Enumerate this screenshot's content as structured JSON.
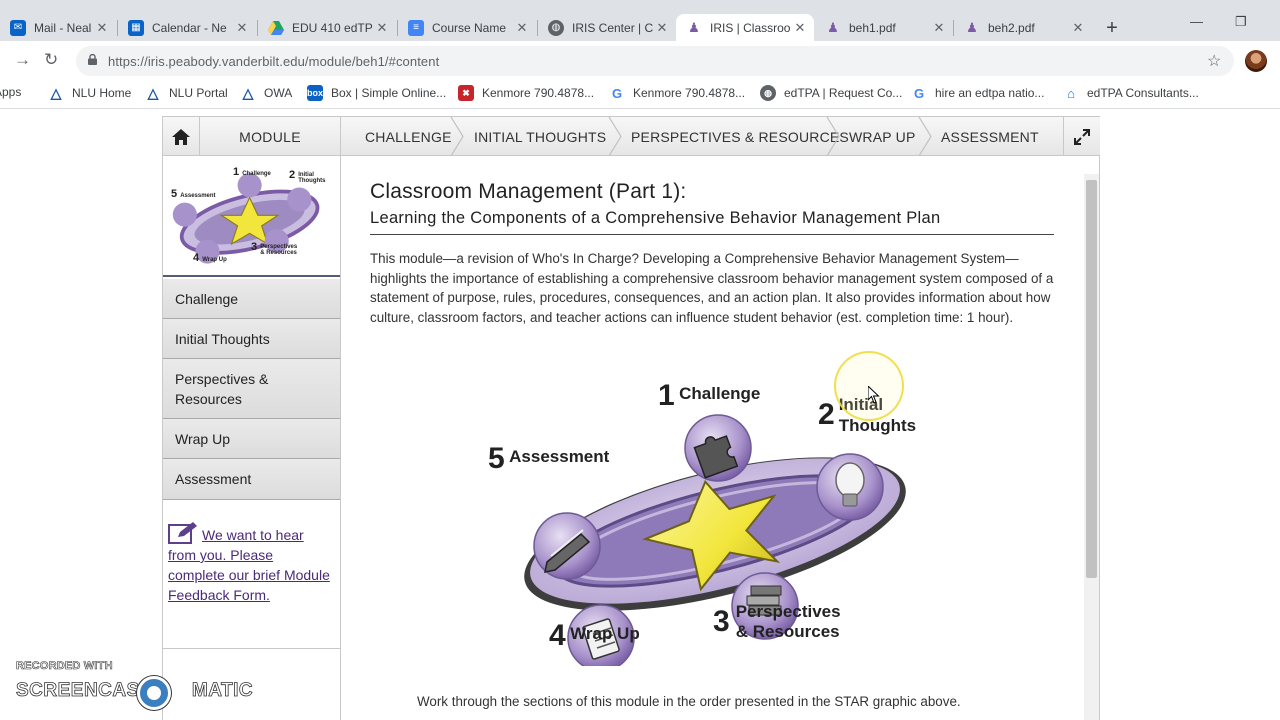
{
  "browser": {
    "tabs": [
      {
        "title": "Mail - Neal Gr",
        "fav": "mail",
        "favColor": "#0a64c8"
      },
      {
        "title": "Calendar - Ne",
        "fav": "calendar",
        "favColor": "#0a64c8"
      },
      {
        "title": "EDU 410 edTP",
        "fav": "drive",
        "favColor": "#1fa463"
      },
      {
        "title": "Course Name",
        "fav": "docs",
        "favColor": "#4285f4"
      },
      {
        "title": "IRIS Center | C",
        "fav": "globe",
        "favColor": "#5f6368"
      },
      {
        "title": "IRIS | Classroo",
        "fav": "iris",
        "favColor": "#7b5aa6"
      },
      {
        "title": "beh1.pdf",
        "fav": "iris",
        "favColor": "#7b5aa6"
      },
      {
        "title": "beh2.pdf",
        "fav": "iris",
        "favColor": "#7b5aa6"
      }
    ],
    "activeTab": 5,
    "url": "https://iris.peabody.vanderbilt.edu/module/beh1/#content",
    "bookmarks": [
      {
        "label": "Apps",
        "icon": "apps-grid"
      },
      {
        "label": "NLU Home",
        "icon": "nlu-logo"
      },
      {
        "label": "NLU Portal",
        "icon": "nlu-logo"
      },
      {
        "label": "OWA",
        "icon": "nlu-logo"
      },
      {
        "label": "Box | Simple Online...",
        "icon": "box-logo"
      },
      {
        "label": "Kenmore 790.4878...",
        "icon": "sears-logo"
      },
      {
        "label": "Kenmore 790.4878...",
        "icon": "google-logo"
      },
      {
        "label": "edTPA | Request Co...",
        "icon": "globe-icon"
      },
      {
        "label": "hire an edtpa natio...",
        "icon": "google-logo"
      },
      {
        "label": "edTPA Consultants...",
        "icon": "house-icon"
      }
    ]
  },
  "moduleNav": {
    "home_icon": "home-icon",
    "module_label": "MODULE",
    "steps": [
      "CHALLENGE",
      "INITIAL THOUGHTS",
      "PERSPECTIVES & RESOURCES",
      "WRAP UP",
      "ASSESSMENT"
    ],
    "expand_icon": "expand-icon"
  },
  "sidebar": {
    "items": [
      "Challenge",
      "Initial Thoughts",
      "Perspectives & Resources",
      "Wrap Up",
      "Assessment"
    ],
    "feedback_link": "We want to hear from you. Please complete our brief Module Feedback Form."
  },
  "content": {
    "title": "Classroom Management (Part 1):",
    "subtitle": "Learning the Components of a Comprehensive Behavior Management Plan",
    "intro": "This module—a revision of Who's In Charge? Developing a Comprehensive Behavior Management System—highlights the importance of establishing a comprehensive classroom behavior management system composed of a statement of purpose, rules, procedures, consequences, and an action plan. It also provides information about how culture, classroom factors, and teacher actions can influence student behavior (est. completion time: 1 hour).",
    "graphic": {
      "steps": [
        {
          "num": "1",
          "label": "Challenge",
          "icon": "puzzle-icon"
        },
        {
          "num": "2",
          "label": "Initial Thoughts",
          "label1": "Initial",
          "label2": "Thoughts",
          "icon": "lightbulb-icon"
        },
        {
          "num": "3",
          "label": "Perspectives & Resources",
          "label1": "Perspectives",
          "label2": "& Resources",
          "icon": "books-icon"
        },
        {
          "num": "4",
          "label": "Wrap Up",
          "icon": "clipboard-icon"
        },
        {
          "num": "5",
          "label": "Assessment",
          "icon": "pencil-icon"
        }
      ],
      "thumb_steps": [
        {
          "num": "1",
          "label": "Challenge"
        },
        {
          "num": "2",
          "label1": "Initial",
          "label2": "Thoughts"
        },
        {
          "num": "3",
          "label1": "Perspectives",
          "label2": "& Resources"
        },
        {
          "num": "4",
          "label": "Wrap Up"
        },
        {
          "num": "5",
          "label": "Assessment"
        }
      ]
    },
    "bottom_text": "Work through the sections of this module in the order presented in the STAR graphic above."
  },
  "watermark": {
    "top": "RECORDED WITH",
    "left": "SCREENCAST",
    "right": "MATIC"
  },
  "colors": {
    "purple": "#7b5aa6",
    "lavender": "#b9a6d3",
    "star": "#f2e63c",
    "link": "#4b2a7a"
  }
}
